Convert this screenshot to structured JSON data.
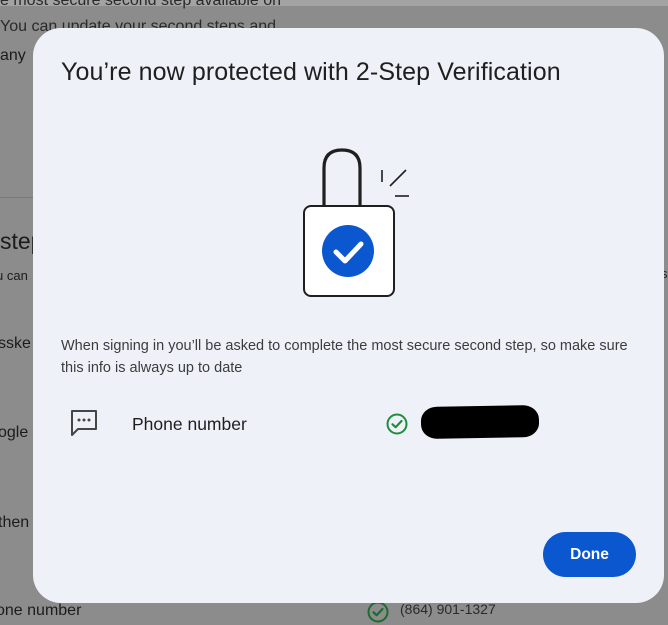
{
  "background": {
    "lines": [
      "e most secure second step available on",
      "You can update your second steps and",
      "any",
      "step",
      "u can",
      "sske",
      "ogle",
      "then",
      "one number"
    ],
    "phone_value": "(864) 901-1327",
    "partial_right_char": "s"
  },
  "modal": {
    "title": "You’re now protected with 2-Step Verification",
    "illustration_icon": "padlock-checkmark-icon",
    "description": "When signing in you’ll be asked to complete the most secure second step, so make sure this info is always up to date",
    "method": {
      "icon": "message-icon",
      "label": "Phone number",
      "status_icon": "check-circle-icon",
      "value_redacted": true
    },
    "done_label": "Done"
  },
  "colors": {
    "accent": "#0b57d0",
    "success": "#1e8e3e",
    "modal_bg": "#eef1f8",
    "scrim": "#8c8c8c"
  }
}
